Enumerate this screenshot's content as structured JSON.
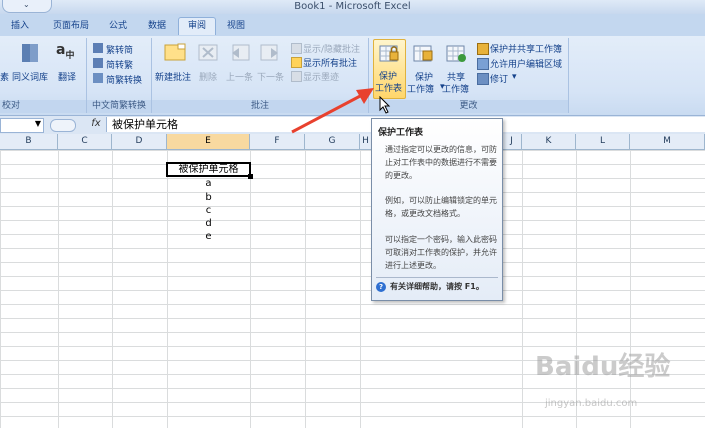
{
  "window": {
    "title": "Book1 - Microsoft Excel"
  },
  "tabs": [
    "插入",
    "页面布局",
    "公式",
    "数据",
    "审阅",
    "视图"
  ],
  "active_tab": "审阅",
  "ribbon": {
    "proofing": {
      "label": "校对",
      "buttons": [
        "素",
        "同义词库",
        "翻译"
      ]
    },
    "chinese_conversion": {
      "label": "中文简繁转换",
      "buttons": [
        "繁转简",
        "简转繁",
        "简繁转换"
      ]
    },
    "comments": {
      "label": "批注",
      "buttons": [
        "新建批注",
        "删除",
        "上一条",
        "下一条"
      ],
      "small_buttons": [
        "显示/隐藏批注",
        "显示所有批注",
        "显示墨迹"
      ]
    },
    "changes": {
      "label": "更改",
      "protect_sheet": [
        "保护",
        "工作表"
      ],
      "protect_workbook": [
        "保护",
        "工作簿"
      ],
      "share_workbook": [
        "共享",
        "工作簿"
      ],
      "small_buttons": [
        "保护并共享工作簿",
        "允许用户编辑区域",
        "修订"
      ]
    }
  },
  "formula_bar": {
    "fx": "fx",
    "content": "被保护单元格"
  },
  "columns": [
    "B",
    "C",
    "D",
    "E",
    "F",
    "G",
    "H",
    "I",
    "J",
    "K",
    "L",
    "M"
  ],
  "cells": {
    "active": "被保护单元格",
    "values": [
      "a",
      "b",
      "c",
      "d",
      "e"
    ]
  },
  "tooltip": {
    "title": "保护工作表",
    "p1": "通过指定可以更改的信息，可防止对工作表中的数据进行不需要的更改。",
    "p2": "例如，可以防止编辑锁定的单元格，或更改文档格式。",
    "p3": "可以指定一个密码，输入此密码可取消对工作表的保护，并允许进行上述更改。",
    "help": "有关详细帮助，请按 F1。"
  },
  "watermark": {
    "brand": "Baidu经验",
    "url": "jingyan.baidu.com"
  },
  "colors": {
    "ribbon": "#d6e4f6",
    "highlight": "#ffd66b",
    "arrow": "#e8412e",
    "selected_col": "#f8d9a0"
  }
}
